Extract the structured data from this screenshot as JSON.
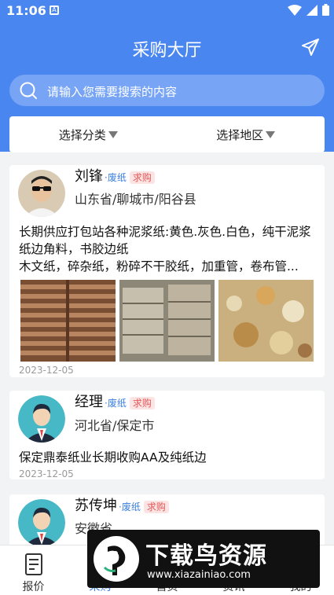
{
  "status_bar": {
    "time": "11:06",
    "notification_glyph": "A"
  },
  "header": {
    "title": "采购大厅"
  },
  "search": {
    "placeholder": "请输入您需要搜索的内容"
  },
  "filters": {
    "category": "选择分类",
    "region": "选择地区"
  },
  "posts": [
    {
      "name": "刘锋",
      "category": "·废纸",
      "type": "求购",
      "location": "山东省/聊城市/阳谷县",
      "description": "长期供应打包站各种泥浆纸:黄色.灰色.白色，纯干泥浆纸边角料，书胶边纸",
      "description_2": "木文纸，碎杂纸，粉碎不干胶纸，加重管，卷布管...",
      "date": "2023-12-05"
    },
    {
      "name": "经理",
      "category": "·废纸",
      "type": "求购",
      "location": "河北省/保定市",
      "description": "保定鼎泰纸业长期收购AA及纯纸边",
      "date": "2023-12-05"
    },
    {
      "name": "苏传坤",
      "category": "·废纸",
      "type": "求购",
      "location": "安徽省"
    }
  ],
  "tabs": [
    {
      "label": "报价",
      "icon": "document-icon"
    },
    {
      "label": "采购",
      "icon": "cart-icon"
    },
    {
      "label": "首页",
      "icon": "home-icon"
    },
    {
      "label": "资讯",
      "icon": "news-icon"
    },
    {
      "label": "我的",
      "icon": "user-icon"
    }
  ],
  "watermark": {
    "title": "下载鸟资源",
    "url": "www.xiazainiao.com"
  },
  "colors": {
    "primary": "#4a86f0",
    "tag_blue": "#3a7de0",
    "tag_red": "#e15a5a"
  }
}
